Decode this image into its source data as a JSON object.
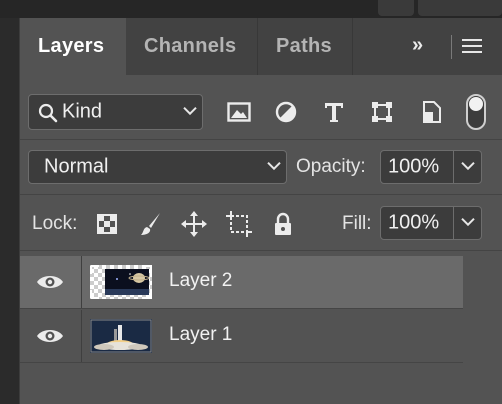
{
  "tabs": [
    {
      "label": "Layers",
      "active": true
    },
    {
      "label": "Channels",
      "active": false
    },
    {
      "label": "Paths",
      "active": false
    }
  ],
  "tab_overflow_label": "»",
  "filter": {
    "label": "Kind",
    "icon": "search-icon"
  },
  "filter_icons": [
    "image-filter-icon",
    "adjustment-filter-icon",
    "type-filter-icon",
    "shape-filter-icon",
    "smart-object-filter-icon"
  ],
  "blend_mode": "Normal",
  "opacity": {
    "label": "Opacity:",
    "value": "100%"
  },
  "lock": {
    "label": "Lock:",
    "icons": [
      "lock-transparent-pixels-icon",
      "lock-image-pixels-icon",
      "lock-position-icon",
      "lock-artboard-icon",
      "lock-all-icon"
    ]
  },
  "fill": {
    "label": "Fill:",
    "value": "100%"
  },
  "layers": [
    {
      "name": "Layer 2",
      "selected": true,
      "visible": true
    },
    {
      "name": "Layer 1",
      "selected": false,
      "visible": true
    }
  ],
  "colors": {
    "panel": "#535353",
    "tabbar": "#424242",
    "field": "#3c3c3c",
    "selected_row": "#6a6a6a"
  }
}
